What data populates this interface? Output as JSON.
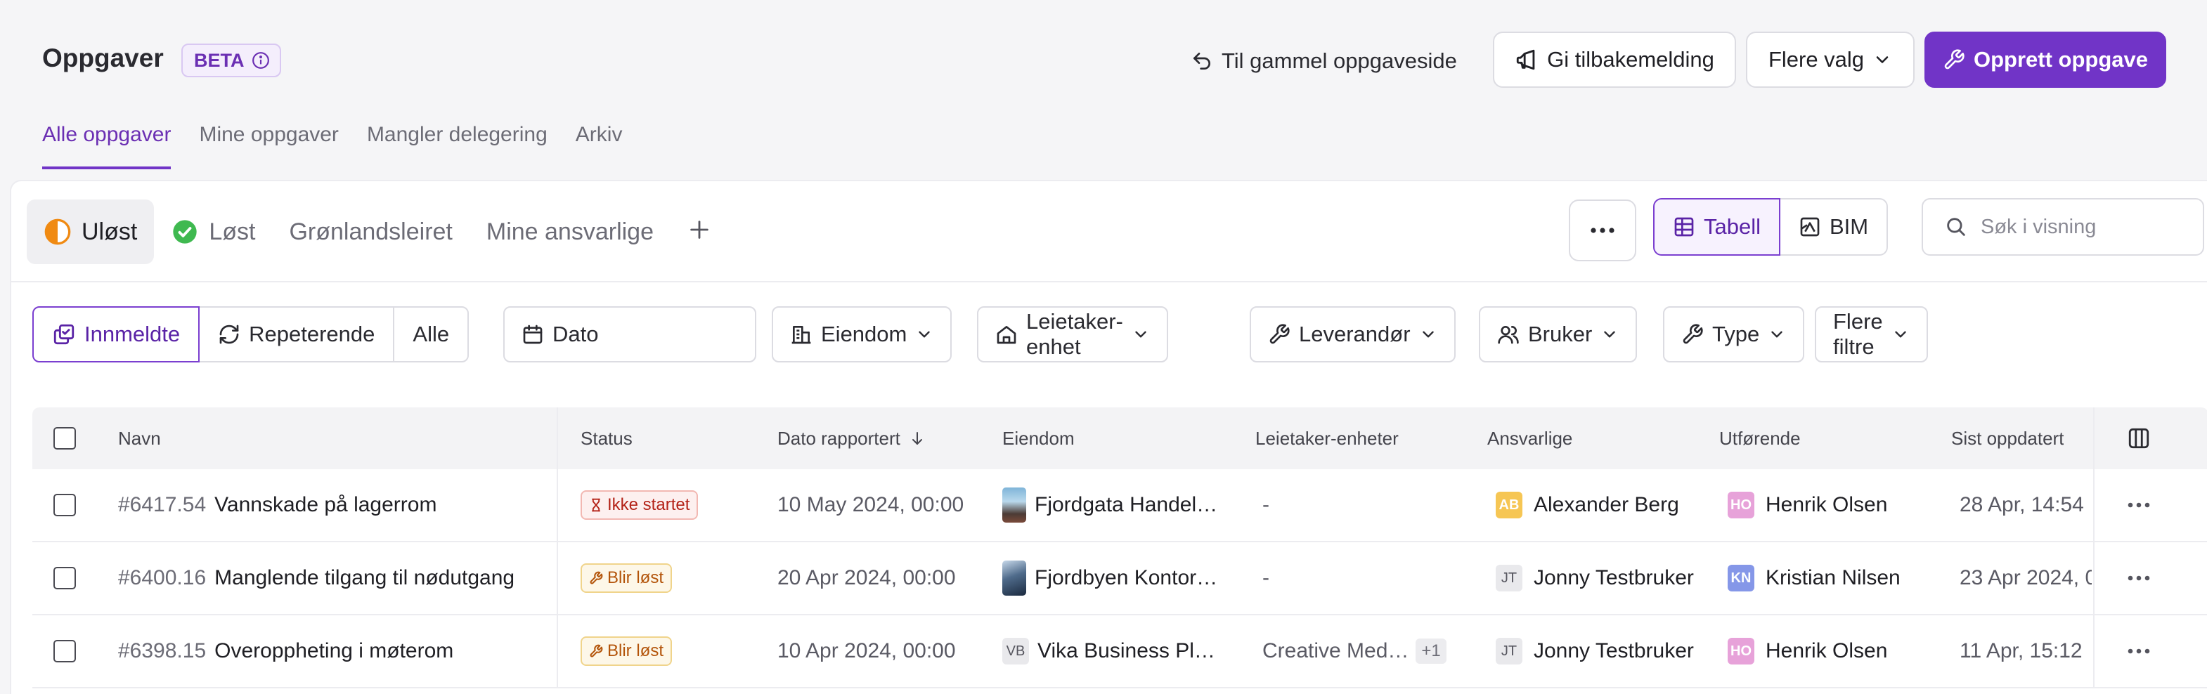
{
  "header": {
    "title": "Oppgaver",
    "beta": "BETA",
    "old_page_link": "Til gammel oppgaveside",
    "feedback_button": "Gi tilbakemelding",
    "more_options_button": "Flere valg",
    "create_button": "Opprett oppgave"
  },
  "tabs": [
    {
      "label": "Alle oppgaver",
      "active": true
    },
    {
      "label": "Mine oppgaver"
    },
    {
      "label": "Mangler delegering"
    },
    {
      "label": "Arkiv"
    }
  ],
  "views": [
    {
      "label": "Uløst",
      "icon": "half-circle-icon",
      "active": true
    },
    {
      "label": "Løst",
      "icon": "check-circle-icon"
    },
    {
      "label": "Grønlandsleiret"
    },
    {
      "label": "Mine ansvarlige"
    }
  ],
  "view_toggle": {
    "table": "Tabell",
    "bim": "BIM"
  },
  "search": {
    "placeholder": "Søk i visning"
  },
  "filters": {
    "segments": [
      "Innmeldte",
      "Repeterende",
      "Alle"
    ],
    "date": "Dato",
    "property": "Eiendom",
    "tenant_unit": "Leietaker-enhet",
    "supplier": "Leverandør",
    "user": "Bruker",
    "type": "Type",
    "more_filters": "Flere filtre"
  },
  "table": {
    "columns": {
      "name": "Navn",
      "status": "Status",
      "date_reported": "Dato rapportert",
      "property": "Eiendom",
      "tenant_units": "Leietaker-enheter",
      "responsible": "Ansvarlige",
      "performer": "Utførende",
      "last_updated": "Sist oppdatert"
    },
    "rows": [
      {
        "id": "#6417.54",
        "name": "Vannskade på lagerrom",
        "status": "Ikke startet",
        "status_kind": "not-started",
        "date": "10 May 2024, 00:00",
        "property": "Fjordgata Handel…",
        "property_thumb": "a",
        "tenant": "-",
        "tenant_extra": "",
        "responsible_initials": "AB",
        "responsible": "Alexander Berg",
        "performer_initials": "HO",
        "performer": "Henrik Olsen",
        "updated": "28 Apr, 14:54"
      },
      {
        "id": "#6400.16",
        "name": "Manglende tilgang til nødutgang",
        "status": "Blir løst",
        "status_kind": "in-progress",
        "date": "20 Apr 2024, 00:00",
        "property": "Fjordbyen Kontor…",
        "property_thumb": "b",
        "tenant": "-",
        "tenant_extra": "",
        "responsible_initials": "JT",
        "responsible": "Jonny Testbruker",
        "performer_initials": "KN",
        "performer": "Kristian Nilsen",
        "updated": "23 Apr 2024, 0"
      },
      {
        "id": "#6398.15",
        "name": "Overoppheting i møterom",
        "status": "Blir løst",
        "status_kind": "in-progress",
        "date": "10 Apr 2024, 00:00",
        "property": "Vika Business Pl…",
        "property_initials": "VB",
        "tenant": "Creative Med…",
        "tenant_extra": "+1",
        "responsible_initials": "JT",
        "responsible": "Jonny Testbruker",
        "performer_initials": "HO",
        "performer": "Henrik Olsen",
        "updated": "11 Apr, 15:12"
      }
    ]
  },
  "colors": {
    "accent": "#7134c7",
    "not_started": "#b42318",
    "in_progress": "#b3540a"
  }
}
